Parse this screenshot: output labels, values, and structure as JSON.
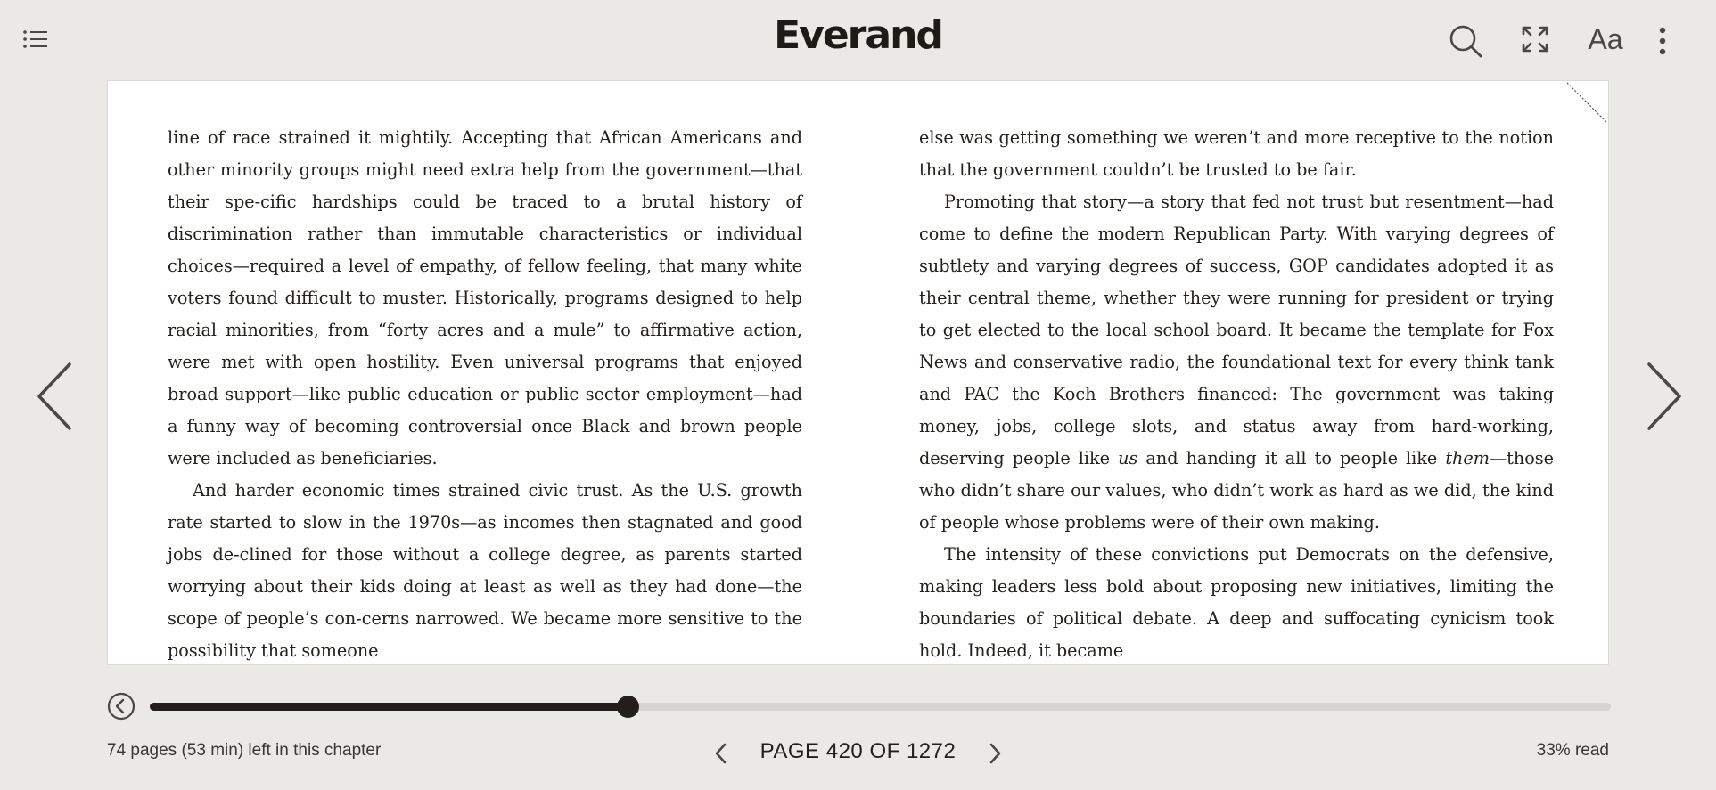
{
  "header": {
    "brand": "Everand",
    "toc_icon": "list-icon",
    "search_icon": "search-icon",
    "fullscreen_icon": "expand-icon",
    "font_settings_label": "Aa",
    "more_icon": "more-vertical-icon"
  },
  "book": {
    "left_column": [
      {
        "text": "line of race strained it mightily. Accepting that African Americans and other minority groups might need extra help from the government—that their spe-cific hardships could be traced to a brutal history of discrimination rather than immutable characteristics or individual choices—required a level of empathy, of fellow feeling, that many white voters found difficult to muster. Historically, programs designed to help racial minorities, from “forty acres and a mule” to affirmative action, were met with open hostility. Even universal programs that enjoyed broad support—like public education or public sector employment—had a funny way of becoming controversial once Black and brown people were included as beneficiaries."
      },
      {
        "text": "And harder economic times strained civic trust. As the U.S. growth rate started to slow in the 1970s—as incomes then stagnated and good jobs de-clined for those without a college degree, as parents started worrying about their kids doing at least as well as they had done—the scope of people’s con-cerns narrowed. We became more sensitive to the possibility that someone"
      }
    ],
    "right_column": {
      "p1": "else was getting something we weren’t and more receptive to the notion that the government couldn’t be trusted to be fair.",
      "p2_before_us": "Promoting that story—a story that fed not trust but resentment—had come to define the modern Republican Party. With varying degrees of subtlety and varying degrees of success, GOP candidates adopted it as their central theme, whether they were running for president or trying to get elected to the local school board. It became the template for Fox News and conservative radio, the foundational text for every think tank and PAC the Koch Brothers financed: The government was taking money, jobs, college slots, and status away from hard-working, deserving people like ",
      "p2_us": "us",
      "p2_middle": " and handing it all to people like ",
      "p2_them": "them",
      "p2_after": "—those who didn’t share our values, who didn’t work as hard as we did, the kind of people whose problems were of their own making.",
      "p3": "The intensity of these convictions put Democrats on the defensive, making leaders less bold about proposing new initiatives, limiting the boundaries of political debate. A deep and suffocating cynicism took hold. Indeed, it became"
    }
  },
  "navigation": {
    "prev_icon": "chevron-left-icon",
    "next_icon": "chevron-right-icon"
  },
  "progress": {
    "back_icon": "back-circle-icon",
    "position_fraction": 0.327
  },
  "footer": {
    "chapter_remaining": "74 pages (53 min) left in this chapter",
    "page_indicator": "PAGE 420 OF 1272",
    "percent_read": "33% read"
  },
  "colors": {
    "background": "#ebe9e6",
    "page": "#ffffff",
    "accent": "#231e1a",
    "track": "#d6d4d1"
  }
}
